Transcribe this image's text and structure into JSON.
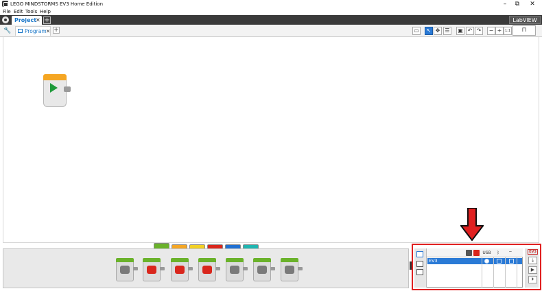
{
  "window": {
    "title": "LEGO MINDSTORMS EV3 Home Edition",
    "controls": {
      "minimize": "–",
      "maximize": "⧉",
      "close": "✕"
    }
  },
  "menu": [
    "File",
    "Edit",
    "Tools",
    "Help"
  ],
  "project": {
    "tab_label": "Project",
    "close_glyph": "✕",
    "add_glyph": "+",
    "logo_text": "LabVIEW"
  },
  "program": {
    "tab_label": "Program",
    "close_glyph": "✕",
    "add_glyph": "+"
  },
  "toolbar": {
    "zoom_reset_label": "1:1",
    "colors": {
      "active": "#2a7ad6"
    }
  },
  "palette": {
    "tab_colors": [
      "#6ab22a",
      "#f5a623",
      "#f2d024",
      "#d9261c",
      "#1f6fd1",
      "#1fb5b0"
    ],
    "blocks": [
      {
        "icon": "medium-motor-icon",
        "color": "#7a7a7a"
      },
      {
        "icon": "large-motor-icon",
        "color": "#d9261c"
      },
      {
        "icon": "move-steering-icon",
        "color": "#d9261c"
      },
      {
        "icon": "move-tank-icon",
        "color": "#d9261c"
      },
      {
        "icon": "display-icon",
        "color": "#7a7a7a"
      },
      {
        "icon": "sound-icon",
        "color": "#7a7a7a"
      },
      {
        "icon": "brick-status-light-icon",
        "color": "#7a7a7a"
      }
    ]
  },
  "hardware": {
    "columns": {
      "usb": "USB",
      "bluetooth": "ᛒ",
      "wifi": "⌔"
    },
    "brick_name": "EV3",
    "right_label": "EV3",
    "highlight_color": "#e02020"
  }
}
